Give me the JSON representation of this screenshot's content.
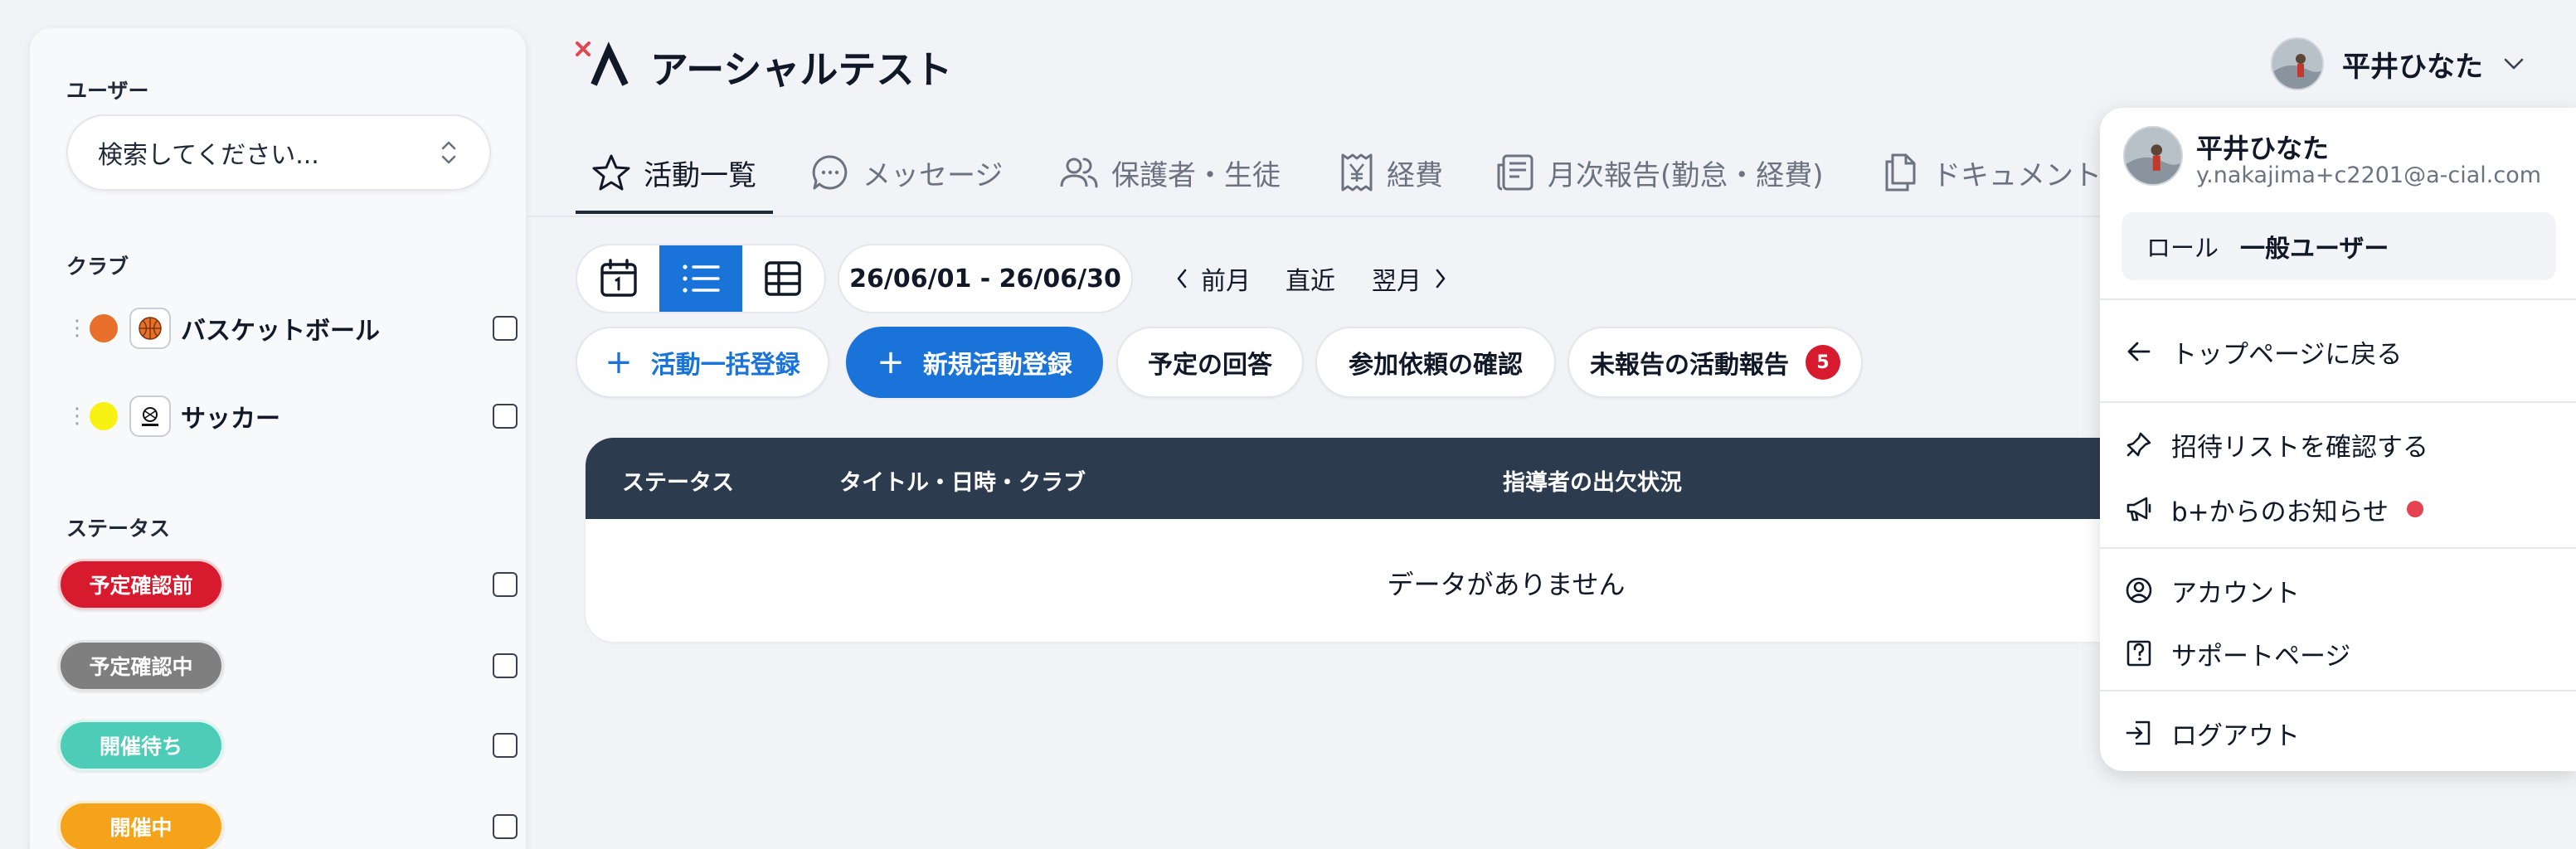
{
  "app": {
    "title": "アーシャルテスト"
  },
  "header": {
    "user_name": "平井ひなた"
  },
  "sidebar": {
    "user_label": "ユーザー",
    "search_placeholder": "検索してください...",
    "club_label": "クラブ",
    "clubs": [
      {
        "name": "バスケットボール",
        "color": "#e8702a",
        "icon": "basketball-icon"
      },
      {
        "name": "サッカー",
        "color": "#f7f213",
        "icon": "soccer-icon"
      }
    ],
    "status_label": "ステータス",
    "statuses": [
      {
        "label": "予定確認前",
        "color": "#d71a2e"
      },
      {
        "label": "予定確認中",
        "color": "#7f7f7f"
      },
      {
        "label": "開催待ち",
        "color": "#4dcdb8"
      },
      {
        "label": "開催中",
        "color": "#f5a31a"
      }
    ]
  },
  "tabs": [
    {
      "label": "活動一覧",
      "icon": "star-icon",
      "active": true
    },
    {
      "label": "メッセージ",
      "icon": "chat-icon",
      "active": false
    },
    {
      "label": "保護者・生徒",
      "icon": "users-icon",
      "active": false
    },
    {
      "label": "経費",
      "icon": "yen-receipt-icon",
      "active": false
    },
    {
      "label": "月次報告(勤怠・経費)",
      "icon": "report-icon",
      "active": false
    },
    {
      "label": "ドキュメント",
      "icon": "document-icon",
      "active": false
    }
  ],
  "toolbar": {
    "view_modes": [
      "calendar-view",
      "list-view",
      "table-view"
    ],
    "active_view": "list-view",
    "date_range": "26/06/01 - 26/06/30",
    "prev_month": "前月",
    "current": "直近",
    "next_month": "翌月",
    "bulk_register": "活動一括登録",
    "new_activity": "新規活動登録",
    "schedule_answer": "予定の回答",
    "participation_check": "参加依頼の確認",
    "unreported": "未報告の活動報告",
    "unreported_count": "5"
  },
  "table": {
    "columns": [
      "ステータス",
      "タイトル・日時・クラブ",
      "指導者の出欠状況"
    ],
    "empty_message": "データがありません"
  },
  "dropdown": {
    "name": "平井ひなた",
    "email": "y.nakajima+c2201@a-cial.com",
    "role_label": "ロール",
    "role_value": "一般ユーザー",
    "back_to_top": "トップページに戻る",
    "invite_list": "招待リストを確認する",
    "news": "b+からのお知らせ",
    "account": "アカウント",
    "support": "サポートページ",
    "logout": "ログアウト"
  },
  "colors": {
    "primary": "#1a73d8",
    "table_header": "#2d3b4f",
    "badge": "#d71a2e"
  }
}
